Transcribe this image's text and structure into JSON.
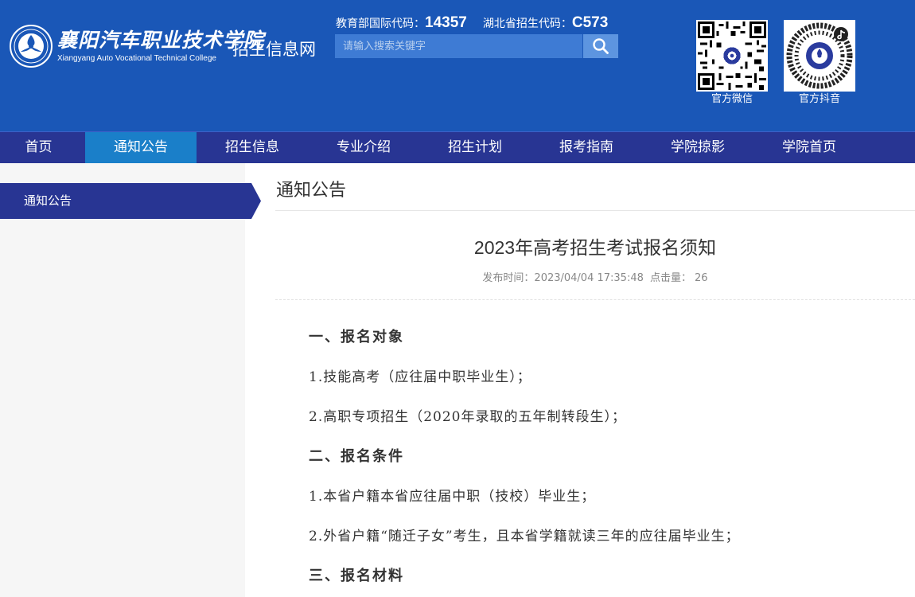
{
  "header": {
    "logo_cn": "襄阳汽车职业技术学院",
    "logo_en": "Xiangyang Auto Vocational Technical College",
    "site_name": "招生信息网",
    "codes": {
      "moe_label": "教育部国际代码：",
      "moe_code": "14357",
      "hubei_label": "湖北省招生代码：",
      "hubei_code": "C573"
    },
    "search": {
      "placeholder": "请输入搜索关键字"
    },
    "qr": [
      {
        "label": "官方微信",
        "icon": "wechat-qr-icon"
      },
      {
        "label": "官方抖音",
        "icon": "douyin-qr-icon"
      }
    ]
  },
  "nav": {
    "items": [
      {
        "label": "首页"
      },
      {
        "label": "通知公告",
        "active": true
      },
      {
        "label": "招生信息"
      },
      {
        "label": "专业介绍"
      },
      {
        "label": "招生计划"
      },
      {
        "label": "报考指南"
      },
      {
        "label": "学院掠影"
      },
      {
        "label": "学院首页"
      }
    ]
  },
  "sidebar": {
    "active_label": "通知公告"
  },
  "main": {
    "section_title": "通知公告",
    "article": {
      "title": "2023年高考招生考试报名须知",
      "date_label": "发布时间：",
      "date": "2023/04/04 17:35:48",
      "hits_label": "点击量：",
      "hits": "26",
      "paragraphs": [
        {
          "text": "一、报名对象",
          "heading": true
        },
        {
          "text": "1.技能高考（应往届中职毕业生）；",
          "heading": false
        },
        {
          "text": "2.高职专项招生（2020年录取的五年制转段生）；",
          "heading": false
        },
        {
          "text": "二、报名条件",
          "heading": true
        },
        {
          "text": "1.本省户籍本省应往届中职（技校）毕业生；",
          "heading": false
        },
        {
          "text": "2.外省户籍“随迁子女”考生，且本省学籍就读三年的应往届毕业生；",
          "heading": false
        },
        {
          "text": "三、报名材料",
          "heading": true
        }
      ]
    }
  },
  "colors": {
    "header_bg": "#1a57b7",
    "nav_bg": "#283593",
    "nav_active": "#1a7fc9",
    "side_active": "#283593",
    "sidebar_bg": "#f6f6f6"
  }
}
